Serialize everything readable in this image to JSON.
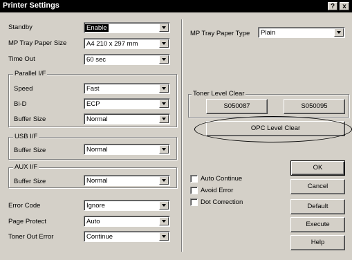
{
  "window": {
    "title": "Printer Settings",
    "help_btn": "?",
    "close_btn": "x"
  },
  "left": {
    "standby": {
      "label": "Standby",
      "value": "Enable"
    },
    "mp_tray_paper_size": {
      "label": "MP Tray Paper Size",
      "value": "A4 210 x 297 mm"
    },
    "time_out": {
      "label": "Time Out",
      "value": "60 sec"
    },
    "parallel": {
      "title": "Parallel I/F",
      "speed": {
        "label": "Speed",
        "value": "Fast"
      },
      "bid": {
        "label": "Bi-D",
        "value": "ECP"
      },
      "buffer": {
        "label": "Buffer Size",
        "value": "Normal"
      }
    },
    "usb": {
      "title": "USB I/F",
      "buffer": {
        "label": "Buffer Size",
        "value": "Normal"
      }
    },
    "aux": {
      "title": "AUX I/F",
      "buffer": {
        "label": "Buffer Size",
        "value": "Normal"
      }
    },
    "error_code": {
      "label": "Error Code",
      "value": "Ignore"
    },
    "page_protect": {
      "label": "Page Protect",
      "value": "Auto"
    },
    "toner_out_error": {
      "label": "Toner Out Error",
      "value": "Continue"
    }
  },
  "right": {
    "mp_tray_paper_type": {
      "label": "MP Tray Paper Type",
      "value": "Plain"
    },
    "toner": {
      "title": "Toner Level Clear",
      "btn1": "S050087",
      "btn2": "S050095"
    },
    "opc_btn": "OPC Level Clear",
    "checks": [
      "Auto Continue",
      "Avoid Error",
      "Dot Correction"
    ],
    "buttons": {
      "ok": "OK",
      "cancel": "Cancel",
      "default": "Default",
      "execute": "Execute",
      "help": "Help"
    }
  }
}
